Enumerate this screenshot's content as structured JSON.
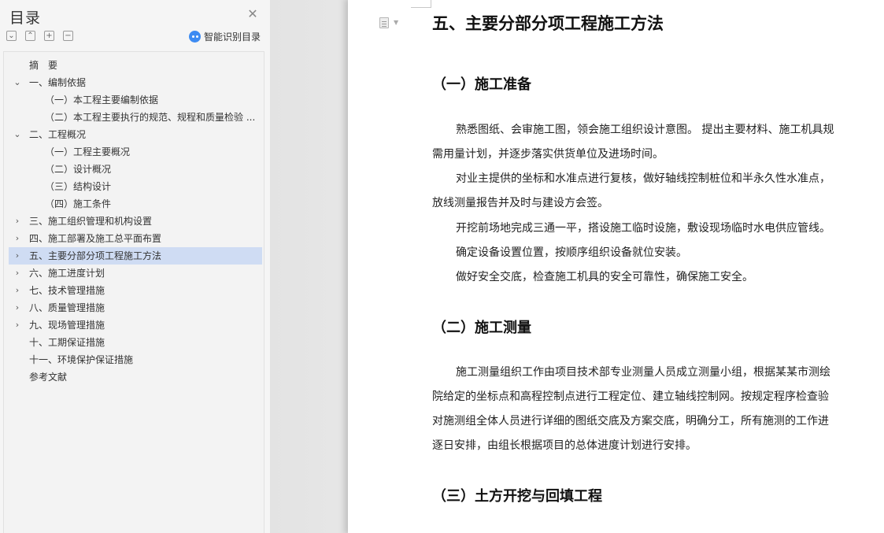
{
  "sidebar": {
    "title": "目录",
    "close_icon": "close-icon",
    "tools": [
      {
        "name": "collapse-all-icon",
        "glyph": "⌄"
      },
      {
        "name": "expand-all-icon",
        "glyph": "⌃"
      },
      {
        "name": "add-heading-icon",
        "glyph": "+"
      },
      {
        "name": "remove-heading-icon",
        "glyph": "−"
      }
    ],
    "smart_toc_label": "智能识别目录",
    "toc": [
      {
        "label": "摘　要",
        "level": 0,
        "chevron": ""
      },
      {
        "label": "一、编制依据",
        "level": 1,
        "chevron": "⌄"
      },
      {
        "label": "（一）本工程主要编制依据",
        "level": 2,
        "chevron": ""
      },
      {
        "label": "（二）本工程主要执行的规范、规程和质量检验 ...",
        "level": 2,
        "chevron": ""
      },
      {
        "label": "二、工程概况",
        "level": 1,
        "chevron": "⌄"
      },
      {
        "label": "（一）工程主要概况",
        "level": 2,
        "chevron": ""
      },
      {
        "label": "（二）设计概况",
        "level": 2,
        "chevron": ""
      },
      {
        "label": "（三）结构设计",
        "level": 2,
        "chevron": ""
      },
      {
        "label": "（四）施工条件",
        "level": 2,
        "chevron": ""
      },
      {
        "label": "三、施工组织管理和机构设置",
        "level": 1,
        "chevron": "›"
      },
      {
        "label": "四、施工部署及施工总平面布置",
        "level": 1,
        "chevron": "›"
      },
      {
        "label": "五、主要分部分项工程施工方法",
        "level": 1,
        "chevron": "›",
        "active": true
      },
      {
        "label": "六、施工进度计划",
        "level": 1,
        "chevron": "›"
      },
      {
        "label": "七、技术管理措施",
        "level": 1,
        "chevron": "›"
      },
      {
        "label": "八、质量管理措施",
        "level": 1,
        "chevron": "›"
      },
      {
        "label": "九、现场管理措施",
        "level": 1,
        "chevron": "›"
      },
      {
        "label": "十、工期保证措施",
        "level": 0,
        "chevron": ""
      },
      {
        "label": "十一、环境保护保证措施",
        "level": 0,
        "chevron": ""
      },
      {
        "label": "参考文献",
        "level": 0,
        "chevron": ""
      }
    ]
  },
  "document": {
    "heading": "五、主要分部分项工程施工方法",
    "sections": [
      {
        "title": "（一）施工准备",
        "lines": [
          "熟悉图纸、会审施工图，领会施工组织设计意图。 提出主要材料、施工机具规",
          "需用量计划，并逐步落实供货单位及进场时间。",
          "对业主提供的坐标和水准点进行复核，做好轴线控制桩位和半永久性水准点，",
          "放线测量报告并及时与建设方会签。",
          "开挖前场地完成三通一平，搭设施工临时设施，敷设现场临时水电供应管线。",
          "确定设备设置位置，按顺序组织设备就位安装。",
          "做好安全交底，检查施工机具的安全可靠性，确保施工安全。"
        ]
      },
      {
        "title": "（二）施工测量",
        "lines": [
          "施工测量组织工作由项目技术部专业测量人员成立测量小组，根据某某市测绘",
          "院给定的坐标点和高程控制点进行工程定位、建立轴线控制网。按规定程序检查验",
          "对施测组全体人员进行详细的图纸交底及方案交底，明确分工，所有施测的工作进",
          "逐日安排，由组长根据项目的总体进度计划进行安排。"
        ]
      },
      {
        "title": "（三）土方开挖与回填工程",
        "lines": []
      }
    ]
  }
}
